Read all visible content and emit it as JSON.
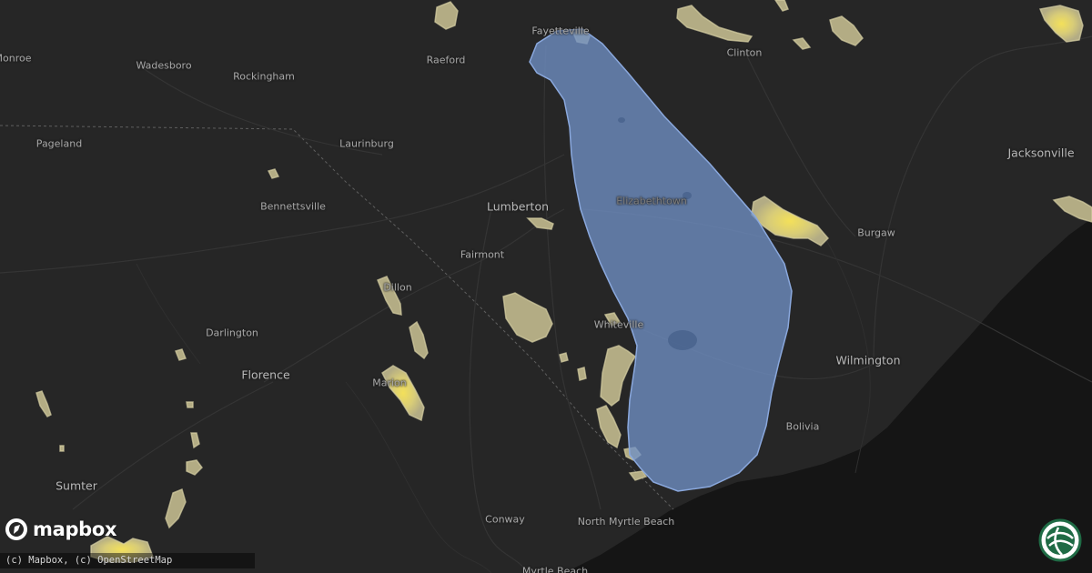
{
  "map": {
    "basemap_style": "dark",
    "colors": {
      "land": "#262626",
      "ocean": "#151515",
      "roads": "#333333",
      "state_border": "#5a5a5a",
      "highlight_fill": "#6f8fc4",
      "highlight_stroke": "#8aa8dd",
      "storm_light": "#c9c08a",
      "storm_yellow": "#f1de58"
    },
    "cities": [
      {
        "name": "Fayetteville"
      },
      {
        "name": "Raeford"
      },
      {
        "name": "Clinton"
      },
      {
        "name": "Wadesboro"
      },
      {
        "name": "Rockingham"
      },
      {
        "name": "Monroe"
      },
      {
        "name": "Pageland"
      },
      {
        "name": "Laurinburg"
      },
      {
        "name": "Jacksonville"
      },
      {
        "name": "Lumberton"
      },
      {
        "name": "Elizabethtown"
      },
      {
        "name": "Bennettsville"
      },
      {
        "name": "Burgaw"
      },
      {
        "name": "Fairmont"
      },
      {
        "name": "Dillon"
      },
      {
        "name": "Whiteville"
      },
      {
        "name": "Darlington"
      },
      {
        "name": "Wilmington"
      },
      {
        "name": "Florence"
      },
      {
        "name": "Marion"
      },
      {
        "name": "Bolivia"
      },
      {
        "name": "Sumter"
      },
      {
        "name": "Conway"
      },
      {
        "name": "North Myrtle Beach"
      },
      {
        "name": "Myrtle Beach"
      }
    ],
    "logo": "mapbox",
    "logo_icon": "mapbox-logo-icon",
    "attribution": "(c) Mapbox, (c) OpenStreetMap",
    "brand_badge_icon": "brand-globe-icon"
  }
}
